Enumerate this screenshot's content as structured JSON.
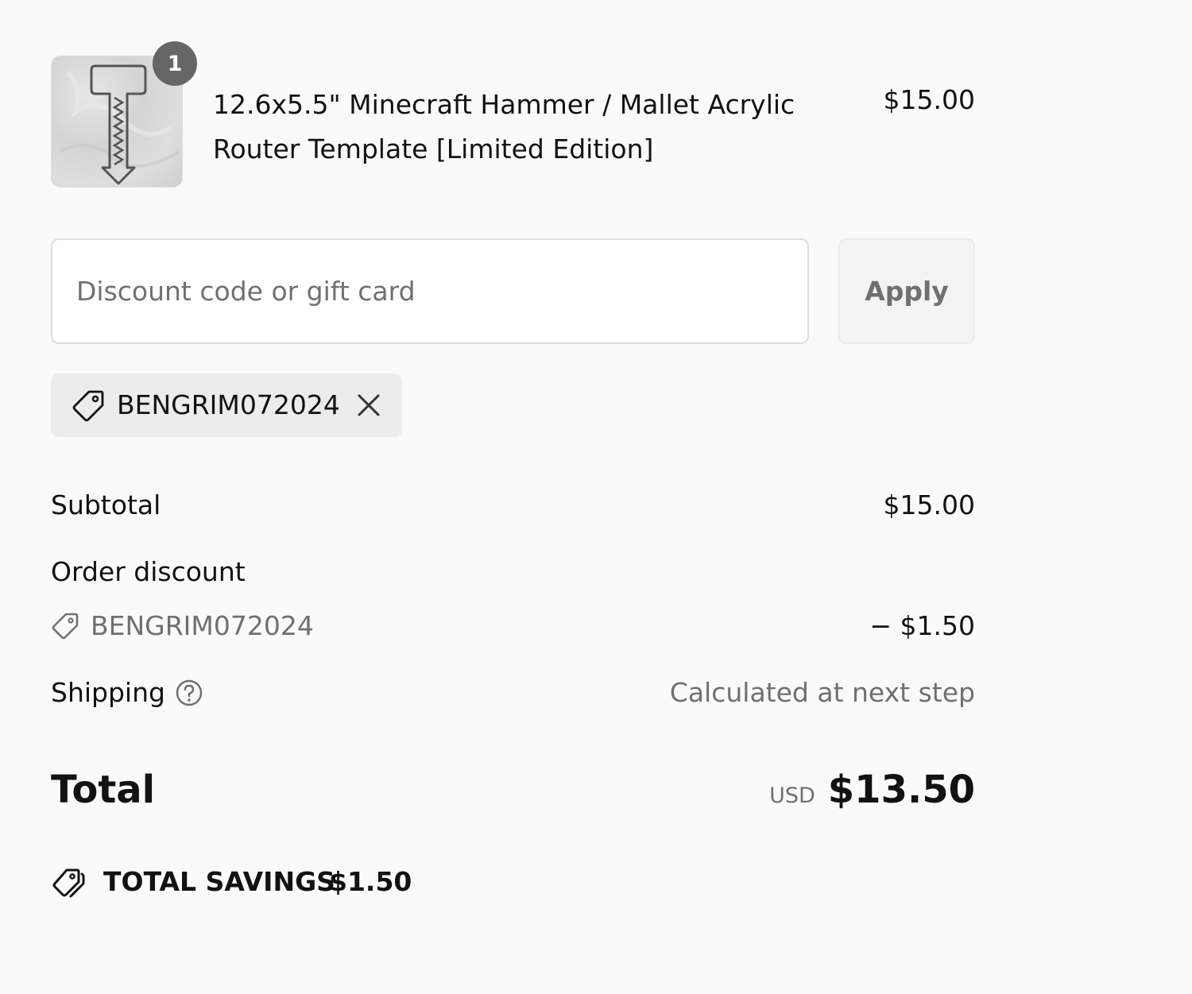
{
  "line_item": {
    "quantity": "1",
    "title": "12.6x5.5\" Minecraft Hammer / Mallet Acrylic Router Template [Limited Edition]",
    "price": "$15.00",
    "image_icon": "hammer-template-thumbnail"
  },
  "discount_form": {
    "placeholder": "Discount code or gift card",
    "value": "",
    "apply_label": "Apply"
  },
  "applied_code": {
    "code": "BENGRIM072024",
    "tag_icon": "tag-icon",
    "remove_icon": "close-icon"
  },
  "totals": {
    "subtotal_label": "Subtotal",
    "subtotal_value": "$15.00",
    "order_discount_label": "Order discount",
    "discount_code": "BENGRIM072024",
    "discount_value": "− $1.50",
    "shipping_label": "Shipping",
    "shipping_value": "Calculated at next step",
    "total_label": "Total",
    "currency": "USD",
    "total_value": "$13.50"
  },
  "savings": {
    "label": "TOTAL SAVINGS",
    "amount": "$1.50"
  },
  "colors": {
    "background": "#fafafa",
    "text": "#121212",
    "muted": "#707070",
    "badge": "#666666",
    "chip": "#ececec"
  }
}
